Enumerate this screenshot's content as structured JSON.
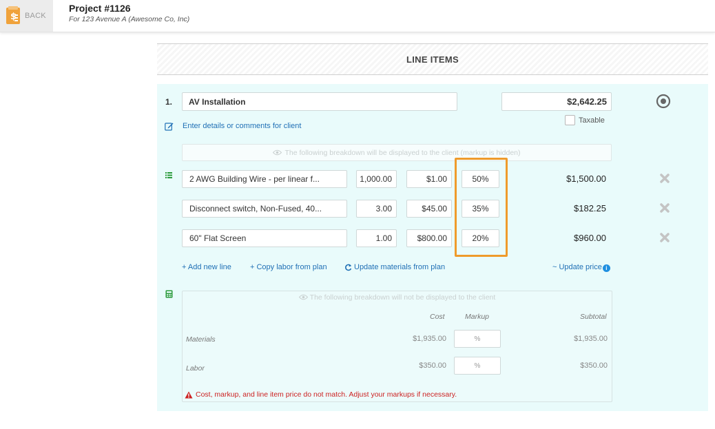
{
  "header": {
    "back_label": "BACK",
    "project_title": "Project #1126",
    "project_subtitle": "For 123 Avenue A (Awesome Co, Inc)"
  },
  "section": {
    "title": "LINE ITEMS"
  },
  "item": {
    "number": "1.",
    "name": "AV Installation",
    "price": "$2,642.25",
    "taxable_label": "Taxable",
    "taxable_checked": false,
    "details_link": "Enter details or comments for client",
    "client_note": "The following breakdown will be displayed to the client (markup is hidden)"
  },
  "rows": [
    {
      "name": "2 AWG Building Wire - per linear f...",
      "qty": "1,000.00",
      "cost": "$1.00",
      "markup": "50%",
      "total": "$1,500.00"
    },
    {
      "name": "Disconnect switch, Non-Fused, 40...",
      "qty": "3.00",
      "cost": "$45.00",
      "markup": "35%",
      "total": "$182.25"
    },
    {
      "name": "60\" Flat Screen",
      "qty": "1.00",
      "cost": "$800.00",
      "markup": "20%",
      "total": "$960.00"
    }
  ],
  "actions": {
    "add_line": "+ Add new line",
    "copy_labor": "+ Copy labor from plan",
    "update_materials": "Update materials from plan",
    "update_price": "~ Update price"
  },
  "breakdown": {
    "note": "The following breakdown will not be displayed to the client",
    "headers": {
      "cost": "Cost",
      "markup": "Markup",
      "subtotal": "Subtotal"
    },
    "materials": {
      "label": "Materials",
      "cost": "$1,935.00",
      "markup_placeholder": "%",
      "subtotal": "$1,935.00"
    },
    "labor": {
      "label": "Labor",
      "cost": "$350.00",
      "markup_placeholder": "%",
      "subtotal": "$350.00"
    },
    "warning": "Cost, markup, and line item price do not match. Adjust your markups if necessary."
  },
  "colors": {
    "accent": "#ef9b2b",
    "link": "#1f6fb5",
    "panel_bg": "#e9fbfb",
    "warning": "#cc2222",
    "back_icon": "#f0a23b"
  },
  "icons": [
    "document-dollar-icon",
    "target-icon",
    "edit-icon",
    "list-icon",
    "close-icon",
    "refresh-icon",
    "info-icon",
    "calculator-icon",
    "eye-icon",
    "warning-icon"
  ]
}
